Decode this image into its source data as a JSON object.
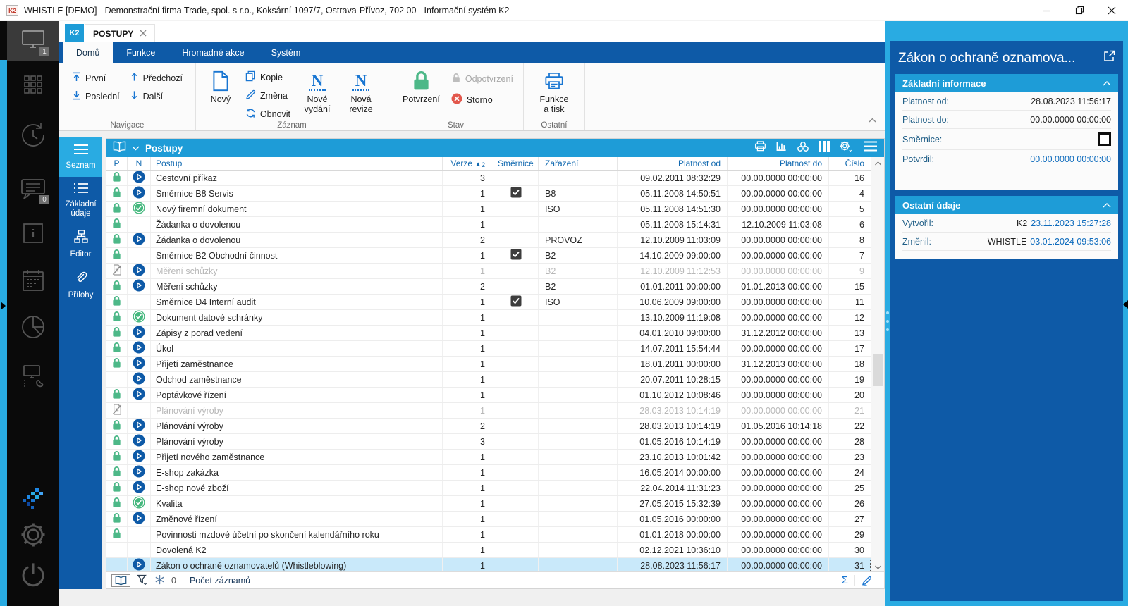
{
  "title_bar": {
    "app_icon": "K2",
    "title": "WHISTLE [DEMO] - Demonstrační firma Trade, spol. s r.o., Koksární 1097/7, Ostrava-Přívoz, 702 00 - Informační systém K2"
  },
  "tabs": {
    "home_tab": "K2",
    "document_tab": "POSTUPY"
  },
  "badges": {
    "desktop": "1",
    "messages": "0"
  },
  "ribbon": {
    "tabs": [
      "Domů",
      "Funkce",
      "Hromadné akce",
      "Systém"
    ],
    "nav": {
      "first": "První",
      "last": "Poslední",
      "prev": "Předchozí",
      "next": "Další"
    },
    "record": {
      "new": "Nový",
      "copy": "Kopie",
      "change": "Změna",
      "refresh": "Obnovit",
      "new_issue": "Nové vydání",
      "new_revision": "Nová revize"
    },
    "state": {
      "confirm": "Potvrzení",
      "unconfirm": "Odpotvrzení",
      "cancel": "Storno"
    },
    "other": {
      "print": "Funkce a tisk"
    },
    "groups": [
      {
        "label": "Navigace"
      },
      {
        "label": "Záznam"
      },
      {
        "label": "Stav"
      },
      {
        "label": "Ostatní"
      }
    ]
  },
  "side_nav": {
    "items": [
      {
        "label": "Seznam"
      },
      {
        "label": "Základní údaje"
      },
      {
        "label": "Editor"
      },
      {
        "label": "Přílohy"
      }
    ]
  },
  "panel": {
    "title": "Postupy",
    "columns": [
      "P",
      "N",
      "Postup",
      "Verze",
      "Směrnice",
      "Zařazení",
      "Platnost od",
      "Platnost do",
      "Číslo"
    ],
    "sort": {
      "column": "Verze",
      "arrow": "▲",
      "priority": "2"
    },
    "rows": [
      {
        "p": "lock",
        "n": "play",
        "postup": "Cestovní příkaz",
        "verze": "3",
        "smernice": false,
        "zarazeni": "",
        "platnost_od": "09.02.2011 08:32:29",
        "platnost_do": "00.00.0000 00:00:00",
        "cislo": "16"
      },
      {
        "p": "lock",
        "n": "play",
        "postup": "Směrnice B8 Servis",
        "verze": "1",
        "smernice": true,
        "zarazeni": "B8",
        "platnost_od": "05.11.2008 14:50:51",
        "platnost_do": "00.00.0000 00:00:00",
        "cislo": "4"
      },
      {
        "p": "lock",
        "n": "check",
        "postup": "Nový firemní dokument",
        "verze": "1",
        "smernice": false,
        "zarazeni": "ISO",
        "platnost_od": "05.11.2008 14:51:30",
        "platnost_do": "00.00.0000 00:00:00",
        "cislo": "5"
      },
      {
        "p": "lock",
        "n": "",
        "postup": "Žádanka o dovolenou",
        "verze": "1",
        "smernice": false,
        "zarazeni": "",
        "platnost_od": "05.11.2008 15:14:31",
        "platnost_do": "12.10.2009 11:03:08",
        "cislo": "6"
      },
      {
        "p": "lock",
        "n": "play",
        "postup": "Žádanka o dovolenou",
        "verze": "2",
        "smernice": false,
        "zarazeni": "PROVOZ",
        "platnost_od": "12.10.2009 11:03:09",
        "platnost_do": "00.00.0000 00:00:00",
        "cislo": "8"
      },
      {
        "p": "lock",
        "n": "",
        "postup": "Směrnice B2 Obchodní činnost",
        "verze": "1",
        "smernice": true,
        "zarazeni": "B2",
        "platnost_od": "14.10.2009 09:00:00",
        "platnost_do": "00.00.0000 00:00:00",
        "cislo": "7"
      },
      {
        "p": "cancelled",
        "n": "play",
        "postup": "Měření schůzky",
        "verze": "1",
        "smernice": false,
        "zarazeni": "B2",
        "platnost_od": "12.10.2009 11:12:53",
        "platnost_do": "00.00.0000 00:00:00",
        "cislo": "9",
        "muted": true
      },
      {
        "p": "lock",
        "n": "play",
        "postup": "Měření schůzky",
        "verze": "2",
        "smernice": false,
        "zarazeni": "B2",
        "platnost_od": "01.01.2011 00:00:00",
        "platnost_do": "01.01.2013 00:00:00",
        "cislo": "15"
      },
      {
        "p": "lock",
        "n": "",
        "postup": "Směrnice D4 Interní audit",
        "verze": "1",
        "smernice": true,
        "zarazeni": "ISO",
        "platnost_od": "10.06.2009 09:00:00",
        "platnost_do": "00.00.0000 00:00:00",
        "cislo": "11"
      },
      {
        "p": "lock",
        "n": "check",
        "postup": "Dokument datové schránky",
        "verze": "1",
        "smernice": false,
        "zarazeni": "",
        "platnost_od": "13.10.2009 11:19:08",
        "platnost_do": "00.00.0000 00:00:00",
        "cislo": "12"
      },
      {
        "p": "lock",
        "n": "play",
        "postup": "Zápisy z porad vedení",
        "verze": "1",
        "smernice": false,
        "zarazeni": "",
        "platnost_od": "04.01.2010 09:00:00",
        "platnost_do": "31.12.2012 00:00:00",
        "cislo": "13"
      },
      {
        "p": "lock",
        "n": "play",
        "postup": "Úkol",
        "verze": "1",
        "smernice": false,
        "zarazeni": "",
        "platnost_od": "14.07.2011 15:54:44",
        "platnost_do": "00.00.0000 00:00:00",
        "cislo": "17"
      },
      {
        "p": "lock",
        "n": "play",
        "postup": "Přijetí zaměstnance",
        "verze": "1",
        "smernice": false,
        "zarazeni": "",
        "platnost_od": "18.01.2011 00:00:00",
        "platnost_do": "31.12.2013 00:00:00",
        "cislo": "18"
      },
      {
        "p": "",
        "n": "play",
        "postup": "Odchod zaměstnance",
        "verze": "1",
        "smernice": false,
        "zarazeni": "",
        "platnost_od": "20.07.2011 10:28:15",
        "platnost_do": "00.00.0000 00:00:00",
        "cislo": "19"
      },
      {
        "p": "lock",
        "n": "play",
        "postup": "Poptávkové řízení",
        "verze": "1",
        "smernice": false,
        "zarazeni": "",
        "platnost_od": "01.10.2012 10:08:46",
        "platnost_do": "00.00.0000 00:00:00",
        "cislo": "20"
      },
      {
        "p": "cancelled",
        "n": "",
        "postup": "Plánování výroby",
        "verze": "1",
        "smernice": false,
        "zarazeni": "",
        "platnost_od": "28.03.2013 10:14:19",
        "platnost_do": "00.00.0000 00:00:00",
        "cislo": "21",
        "muted": true
      },
      {
        "p": "lock",
        "n": "play",
        "postup": "Plánování výroby",
        "verze": "2",
        "smernice": false,
        "zarazeni": "",
        "platnost_od": "28.03.2013 10:14:19",
        "platnost_do": "01.05.2016 10:14:18",
        "cislo": "22"
      },
      {
        "p": "lock",
        "n": "play",
        "postup": "Plánování výroby",
        "verze": "3",
        "smernice": false,
        "zarazeni": "",
        "platnost_od": "01.05.2016 10:14:19",
        "platnost_do": "00.00.0000 00:00:00",
        "cislo": "28"
      },
      {
        "p": "lock",
        "n": "play",
        "postup": "Přijetí nového zaměstnance",
        "verze": "1",
        "smernice": false,
        "zarazeni": "",
        "platnost_od": "23.10.2013 10:01:42",
        "platnost_do": "00.00.0000 00:00:00",
        "cislo": "23"
      },
      {
        "p": "lock",
        "n": "play",
        "postup": "E-shop zakázka",
        "verze": "1",
        "smernice": false,
        "zarazeni": "",
        "platnost_od": "16.05.2014 00:00:00",
        "platnost_do": "00.00.0000 00:00:00",
        "cislo": "24"
      },
      {
        "p": "lock",
        "n": "play",
        "postup": "E-shop nové zboží",
        "verze": "1",
        "smernice": false,
        "zarazeni": "",
        "platnost_od": "22.04.2014 11:31:23",
        "platnost_do": "00.00.0000 00:00:00",
        "cislo": "25"
      },
      {
        "p": "lock",
        "n": "check",
        "postup": "Kvalita",
        "verze": "1",
        "smernice": false,
        "zarazeni": "",
        "platnost_od": "27.05.2015 15:32:39",
        "platnost_do": "00.00.0000 00:00:00",
        "cislo": "26"
      },
      {
        "p": "lock",
        "n": "play",
        "postup": "Změnové řízení",
        "verze": "1",
        "smernice": false,
        "zarazeni": "",
        "platnost_od": "01.05.2016 00:00:00",
        "platnost_do": "00.00.0000 00:00:00",
        "cislo": "27"
      },
      {
        "p": "lock",
        "n": "",
        "postup": "Povinnosti mzdové účetní po skončení kalendářního roku",
        "verze": "1",
        "smernice": false,
        "zarazeni": "",
        "platnost_od": "01.01.2018 00:00:00",
        "platnost_do": "00.00.0000 00:00:00",
        "cislo": "29"
      },
      {
        "p": "",
        "n": "",
        "postup": "Dovolená K2",
        "verze": "1",
        "smernice": false,
        "zarazeni": "",
        "platnost_od": "02.12.2021 10:36:10",
        "platnost_do": "00.00.0000 00:00:00",
        "cislo": "30"
      },
      {
        "p": "",
        "n": "play",
        "postup": "Zákon o ochraně oznamovatelů (Whistleblowing)",
        "verze": "1",
        "smernice": false,
        "zarazeni": "",
        "platnost_od": "28.08.2023 11:56:17",
        "platnost_do": "00.00.0000 00:00:00",
        "cislo": "31",
        "selected": true
      }
    ]
  },
  "status_bar": {
    "linked_count": "0",
    "record_count_label": "Počet záznamů"
  },
  "detail": {
    "title": "Zákon o ochraně oznamova...",
    "sections": [
      {
        "title": "Základní informace",
        "rows": [
          {
            "label": "Platnost od:",
            "value": "28.08.2023 11:56:17"
          },
          {
            "label": "Platnost do:",
            "value": "00.00.0000 00:00:00"
          },
          {
            "label": "Směrnice:"
          },
          {
            "label": "Potvrdil:",
            "value": "00.00.0000 00:00:00"
          }
        ]
      },
      {
        "title": "Ostatní údaje",
        "rows": [
          {
            "label": "Vytvořil:",
            "user": "K2",
            "value": "23.11.2023 15:27:28"
          },
          {
            "label": "Změnil:",
            "user": "WHISTLE",
            "value": "03.01.2024 09:53:06"
          }
        ]
      }
    ]
  },
  "colors": {
    "accent_cyan": "#29abe2",
    "dark_blue": "#0e5aa7",
    "header_blue": "#1e9cd7",
    "green": "#4db888",
    "red": "#e2574c",
    "selection": "#c9e9fa"
  }
}
